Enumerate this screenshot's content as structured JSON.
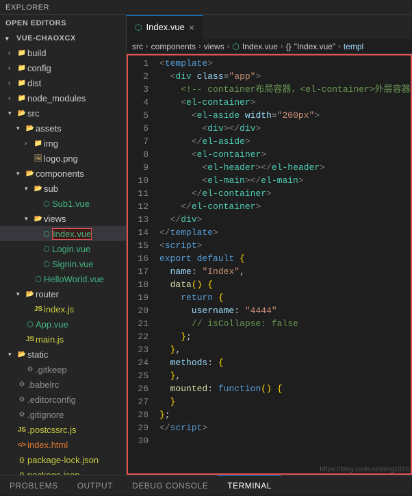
{
  "topbar": {
    "label": "EXPLORER"
  },
  "sidebar": {
    "open_editors_label": "OPEN EDITORS",
    "project_label": "VUE-CHAOXCX",
    "items": [
      {
        "id": "build",
        "label": "build",
        "type": "folder",
        "indent": 1,
        "expanded": false
      },
      {
        "id": "config",
        "label": "config",
        "type": "folder",
        "indent": 1,
        "expanded": false
      },
      {
        "id": "dist",
        "label": "dist",
        "type": "folder",
        "indent": 1,
        "expanded": false
      },
      {
        "id": "node_modules",
        "label": "node_modules",
        "type": "folder",
        "indent": 1,
        "expanded": false
      },
      {
        "id": "src",
        "label": "src",
        "type": "folder",
        "indent": 1,
        "expanded": true
      },
      {
        "id": "assets",
        "label": "assets",
        "type": "folder",
        "indent": 2,
        "expanded": true
      },
      {
        "id": "img",
        "label": "img",
        "type": "folder",
        "indent": 3,
        "expanded": false
      },
      {
        "id": "logo.png",
        "label": "logo.png",
        "type": "img",
        "indent": 3
      },
      {
        "id": "components",
        "label": "components",
        "type": "folder",
        "indent": 2,
        "expanded": true
      },
      {
        "id": "sub",
        "label": "sub",
        "type": "folder",
        "indent": 3,
        "expanded": true
      },
      {
        "id": "Sub1.vue",
        "label": "Sub1.vue",
        "type": "vue",
        "indent": 4
      },
      {
        "id": "views",
        "label": "views",
        "type": "folder",
        "indent": 3,
        "expanded": true
      },
      {
        "id": "Index.vue",
        "label": "Index.vue",
        "type": "vue",
        "indent": 4,
        "selected": true
      },
      {
        "id": "Login.vue",
        "label": "Login.vue",
        "type": "vue",
        "indent": 4
      },
      {
        "id": "Signin.vue",
        "label": "Signin.vue",
        "type": "vue",
        "indent": 4
      },
      {
        "id": "HelloWorld.vue",
        "label": "HelloWorld.vue",
        "type": "vue",
        "indent": 3
      },
      {
        "id": "router",
        "label": "router",
        "type": "folder",
        "indent": 2,
        "expanded": true
      },
      {
        "id": "index.js",
        "label": "index.js",
        "type": "js",
        "indent": 3
      },
      {
        "id": "App.vue",
        "label": "App.vue",
        "type": "vue",
        "indent": 2
      },
      {
        "id": "main.js",
        "label": "main.js",
        "type": "js",
        "indent": 2
      },
      {
        "id": "static",
        "label": "static",
        "type": "folder",
        "indent": 1,
        "expanded": true
      },
      {
        "id": ".gitkeep",
        "label": ".gitkeep",
        "type": "dot",
        "indent": 2
      },
      {
        "id": ".babelrc",
        "label": ".babelrc",
        "type": "dot",
        "indent": 1
      },
      {
        "id": ".editorconfig",
        "label": ".editorconfig",
        "type": "dot",
        "indent": 1
      },
      {
        "id": ".gitignore",
        "label": ".gitignore",
        "type": "dot",
        "indent": 1
      },
      {
        "id": ".postcssrc.js",
        "label": ".postcssrc.js",
        "type": "js",
        "indent": 1
      },
      {
        "id": "index.html",
        "label": "index.html",
        "type": "html",
        "indent": 1
      },
      {
        "id": "package-lock.json",
        "label": "package-lock.json",
        "type": "json",
        "indent": 1
      },
      {
        "id": "package.json",
        "label": "package.json",
        "type": "json",
        "indent": 1
      }
    ]
  },
  "editor": {
    "tab_label": "Index.vue",
    "tab_close": "×",
    "breadcrumb": [
      "src",
      ">",
      "components",
      ">",
      "views",
      ">",
      "Index.vue",
      ">",
      "{}",
      "\"Index.vue\"",
      ">",
      "templ"
    ],
    "code_lines": [
      {
        "n": 1,
        "html": "<span class='lt'>&lt;</span><span class='kw'>template</span><span class='lt'>&gt;</span>"
      },
      {
        "n": 2,
        "html": "  <span class='lt'>&lt;</span><span class='tag-name'>div</span> <span class='attr'>class</span><span class='op'>=</span><span class='val'>\"app\"</span><span class='lt'>&gt;</span>"
      },
      {
        "n": 3,
        "html": "    <span class='cmt'>&lt;!-- container布局容器，&lt;el-container&gt;外层容器</span>"
      },
      {
        "n": 4,
        "html": "    <span class='lt'>&lt;</span><span class='component'>el-container</span><span class='lt'>&gt;</span>"
      },
      {
        "n": 5,
        "html": "      <span class='lt'>&lt;</span><span class='component'>el-aside</span> <span class='attr'>width</span><span class='op'>=</span><span class='val'>\"200px\"</span><span class='lt'>&gt;</span>"
      },
      {
        "n": 6,
        "html": "        <span class='lt'>&lt;</span><span class='tag-name'>div</span><span class='lt'>&gt;&lt;/</span><span class='tag-name'>div</span><span class='lt'>&gt;</span>"
      },
      {
        "n": 7,
        "html": "      <span class='lt'>&lt;/</span><span class='component'>el-aside</span><span class='lt'>&gt;</span>"
      },
      {
        "n": 8,
        "html": "      <span class='lt'>&lt;</span><span class='component'>el-container</span><span class='lt'>&gt;</span>"
      },
      {
        "n": 9,
        "html": "        <span class='lt'>&lt;</span><span class='component'>el-header</span><span class='lt'>&gt;&lt;/</span><span class='component'>el-header</span><span class='lt'>&gt;</span>"
      },
      {
        "n": 10,
        "html": "        <span class='lt'>&lt;</span><span class='component'>el-main</span><span class='lt'>&gt;&lt;/</span><span class='component'>el-main</span><span class='lt'>&gt;</span>"
      },
      {
        "n": 11,
        "html": "      <span class='lt'>&lt;/</span><span class='component'>el-container</span><span class='lt'>&gt;</span>"
      },
      {
        "n": 12,
        "html": "    <span class='lt'>&lt;/</span><span class='component'>el-container</span><span class='lt'>&gt;</span>"
      },
      {
        "n": 13,
        "html": "  <span class='lt'>&lt;/</span><span class='tag-name'>div</span><span class='lt'>&gt;</span>"
      },
      {
        "n": 14,
        "html": "<span class='lt'>&lt;/</span><span class='kw'>template</span><span class='lt'>&gt;</span>"
      },
      {
        "n": 15,
        "html": "<span class='lt'>&lt;</span><span class='kw'>script</span><span class='lt'>&gt;</span>"
      },
      {
        "n": 16,
        "html": "<span class='kw'>export</span> <span class='kw'>default</span> <span class='bracket'>{</span>"
      },
      {
        "n": 17,
        "html": "  <span class='key'>name</span><span class='op'>:</span> <span class='str'>\"Index\"</span><span class='punct'>,</span>"
      },
      {
        "n": 18,
        "html": "  <span class='fn'>data</span><span class='bracket'>()</span> <span class='bracket'>{</span>"
      },
      {
        "n": 19,
        "html": "    <span class='kw'>return</span> <span class='bracket'>{</span>"
      },
      {
        "n": 20,
        "html": "      <span class='key'>username</span><span class='op'>:</span> <span class='str'>\"4444\"</span>"
      },
      {
        "n": 21,
        "html": "      <span class='cmt'>// isCollapse: false</span>"
      },
      {
        "n": 22,
        "html": "    <span class='bracket'>}</span><span class='punct'>;</span>"
      },
      {
        "n": 23,
        "html": "  <span class='bracket'>}</span><span class='punct'>,</span>"
      },
      {
        "n": 24,
        "html": "  <span class='key'>methods</span><span class='op'>:</span> <span class='bracket'>{</span>"
      },
      {
        "n": 25,
        "html": "  <span class='bracket'>}</span><span class='punct'>,</span>"
      },
      {
        "n": 26,
        "html": "  <span class='fn'>mounted</span><span class='op'>:</span> <span class='kw'>function</span><span class='bracket'>()</span> <span class='bracket'>{</span>"
      },
      {
        "n": 27,
        "html": "  <span class='bracket'>}</span>"
      },
      {
        "n": 28,
        "html": "<span class='bracket'>}</span><span class='punct'>;</span>"
      },
      {
        "n": 29,
        "html": "<span class='lt'>&lt;/</span><span class='kw'>script</span><span class='lt'>&gt;</span>"
      },
      {
        "n": 30,
        "html": ""
      }
    ]
  },
  "bottom_tabs": [
    {
      "id": "problems",
      "label": "PROBLEMS"
    },
    {
      "id": "output",
      "label": "OUTPUT"
    },
    {
      "id": "debug",
      "label": "DEBUG CONSOLE"
    },
    {
      "id": "terminal",
      "label": "TERMINAL",
      "active": true
    }
  ],
  "watermark": "https://blog.csdn.net/shg1026"
}
